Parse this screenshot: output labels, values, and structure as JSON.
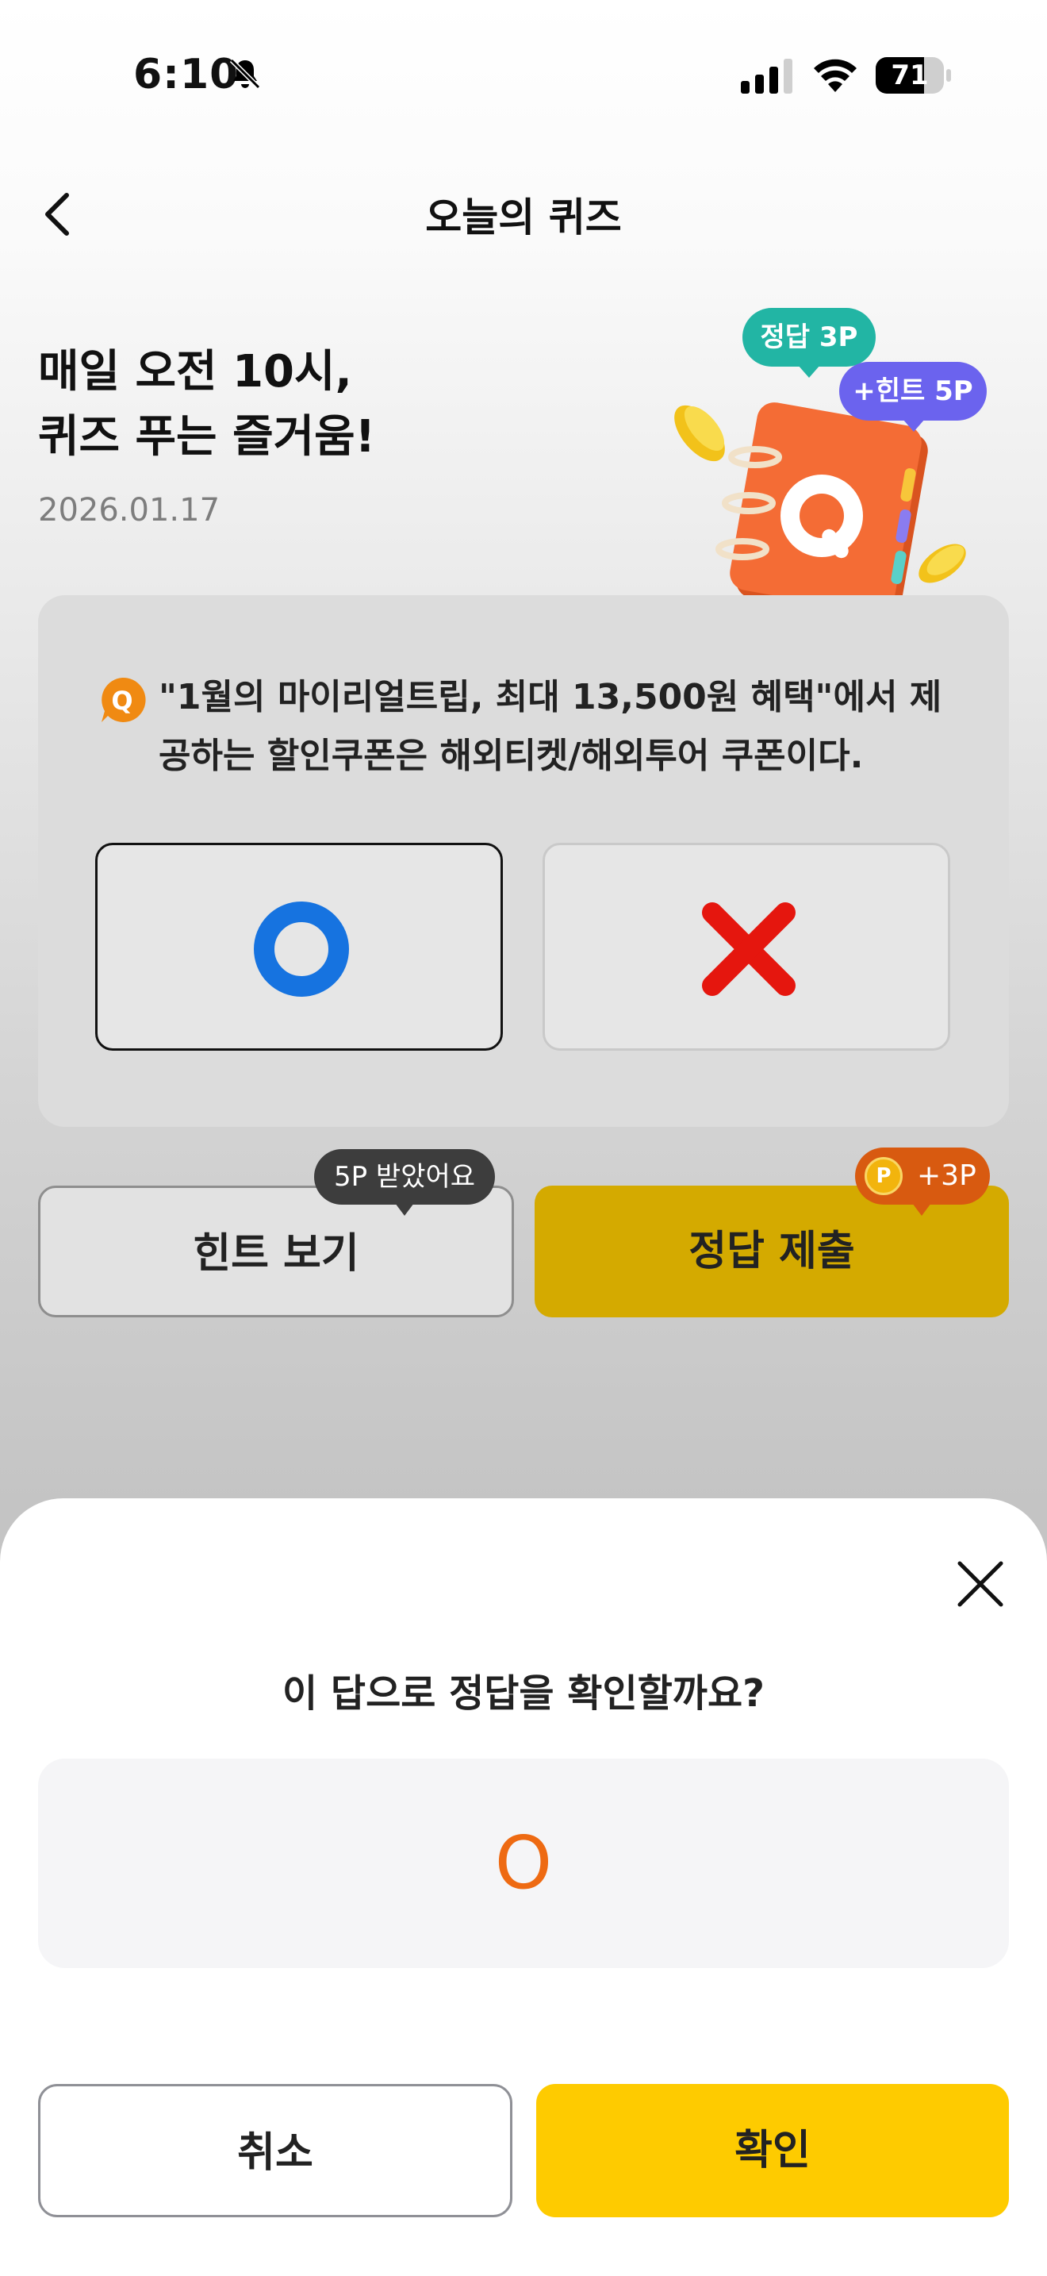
{
  "status_bar": {
    "time": "6:10",
    "battery": "71",
    "battery_level_percent": 71
  },
  "header": {
    "title": "오늘의 퀴즈",
    "back_icon": "chevron-left-icon"
  },
  "hero": {
    "line1": "매일 오전 10시,",
    "line2": "퀴즈 푸는 즐거움!",
    "date": "2026.01.17",
    "bubble_correct": "정답 3P",
    "bubble_hint": "+힌트 5P"
  },
  "quiz": {
    "badge": "Q",
    "question_line1": "\"1월의 마이리얼트립, 최대 13,500원 혜택\"에서 제",
    "question_line2": "공하는 할인쿠폰은 해외티켓/해외투어 쿠폰이다.",
    "options": [
      {
        "id": "O",
        "icon": "circle-o-icon",
        "color": "#1673e0",
        "selected": true
      },
      {
        "id": "X",
        "icon": "x-mark-icon",
        "color": "#e5160e",
        "selected": false
      }
    ]
  },
  "actions": {
    "hint_label": "힌트 보기",
    "hint_tooltip": "5P 받았어요",
    "submit_label": "정답 제출",
    "point_coin": "P",
    "point_tooltip": "+3P"
  },
  "sheet": {
    "question": "이 답으로 정답을 확인할까요?",
    "answer": "O",
    "cancel_label": "취소",
    "confirm_label": "확인"
  },
  "colors": {
    "accent_yellow": "#fecb00",
    "answer_orange": "#ee6a12",
    "correct_teal": "#22b5a4",
    "hint_purple": "#6b63ee"
  }
}
